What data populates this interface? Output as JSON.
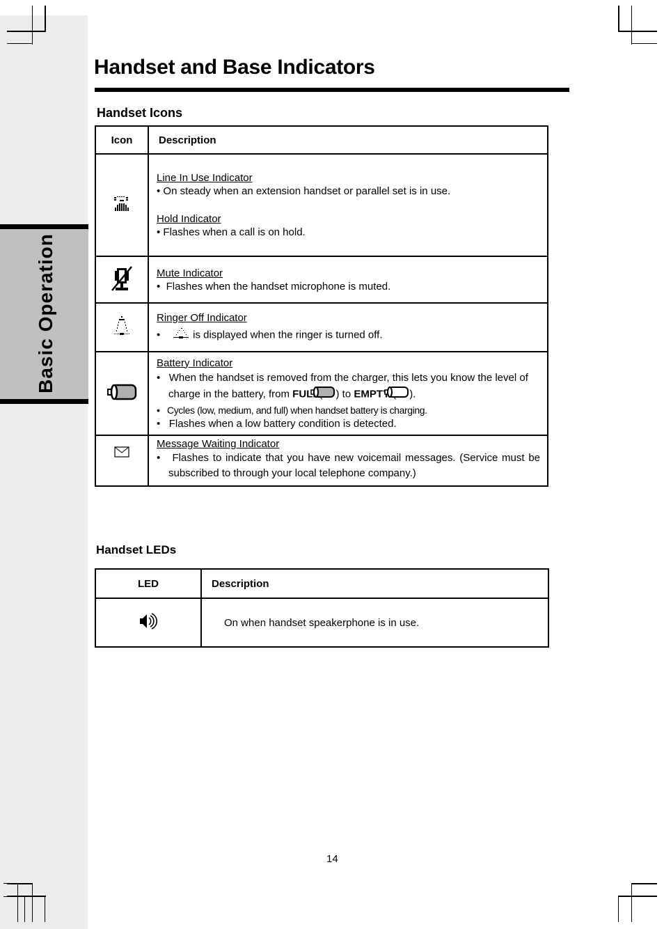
{
  "page": {
    "title": "Handset and Base Indicators",
    "side_tab": "Basic Operation",
    "page_number": "14"
  },
  "handset_icons": {
    "section_title": "Handset Icons",
    "columns": [
      "Icon",
      "Description"
    ],
    "rows": [
      {
        "icon": "line-in-use-hold-icon",
        "entries": [
          {
            "heading": "Line In Use Indicator",
            "bullets": [
              "• On steady when an extension handset or parallel set is in use."
            ]
          },
          {
            "heading": "Hold Indicator",
            "bullets": [
              "• Flashes when a call is on hold."
            ]
          }
        ]
      },
      {
        "icon": "mute-icon",
        "entries": [
          {
            "heading": "Mute Indicator",
            "bullets": [
              "•  Flashes when the handset microphone is muted."
            ]
          }
        ]
      },
      {
        "icon": "ringer-off-icon",
        "entries": [
          {
            "heading": "Ringer Off Indicator",
            "bullets": [
              "is displayed when the ringer is turned off."
            ]
          }
        ]
      },
      {
        "icon": "battery-icon",
        "entries": [
          {
            "heading": "Battery Indicator",
            "bullets": [
              "When the handset is removed from the charger, this lets you know the level of charge in the battery, from",
              "Cycles (low, medium, and  full) when handset battery is charging.",
              "Flashes when a low battery condition is detected."
            ],
            "full_label": "FULL",
            "empty_label": "EMPTY",
            "to_word": "to"
          }
        ]
      },
      {
        "icon": "message-waiting-icon",
        "entries": [
          {
            "heading": "Message Waiting Indicator",
            "bullets": [
              "Flashes to indicate that you have new voicemail messages. (Service must be subscribed to through your local telephone company.)"
            ]
          }
        ]
      }
    ]
  },
  "handset_leds": {
    "section_title": "Handset LEDs",
    "columns": [
      "LED",
      "Description"
    ],
    "rows": [
      {
        "icon": "speakerphone-icon",
        "description": "On when handset speakerphone is in use."
      }
    ]
  },
  "colors": {
    "side_strip": "#ececec",
    "side_tab": "#c0c0c0",
    "battery_fill": "#b0b0b0"
  }
}
